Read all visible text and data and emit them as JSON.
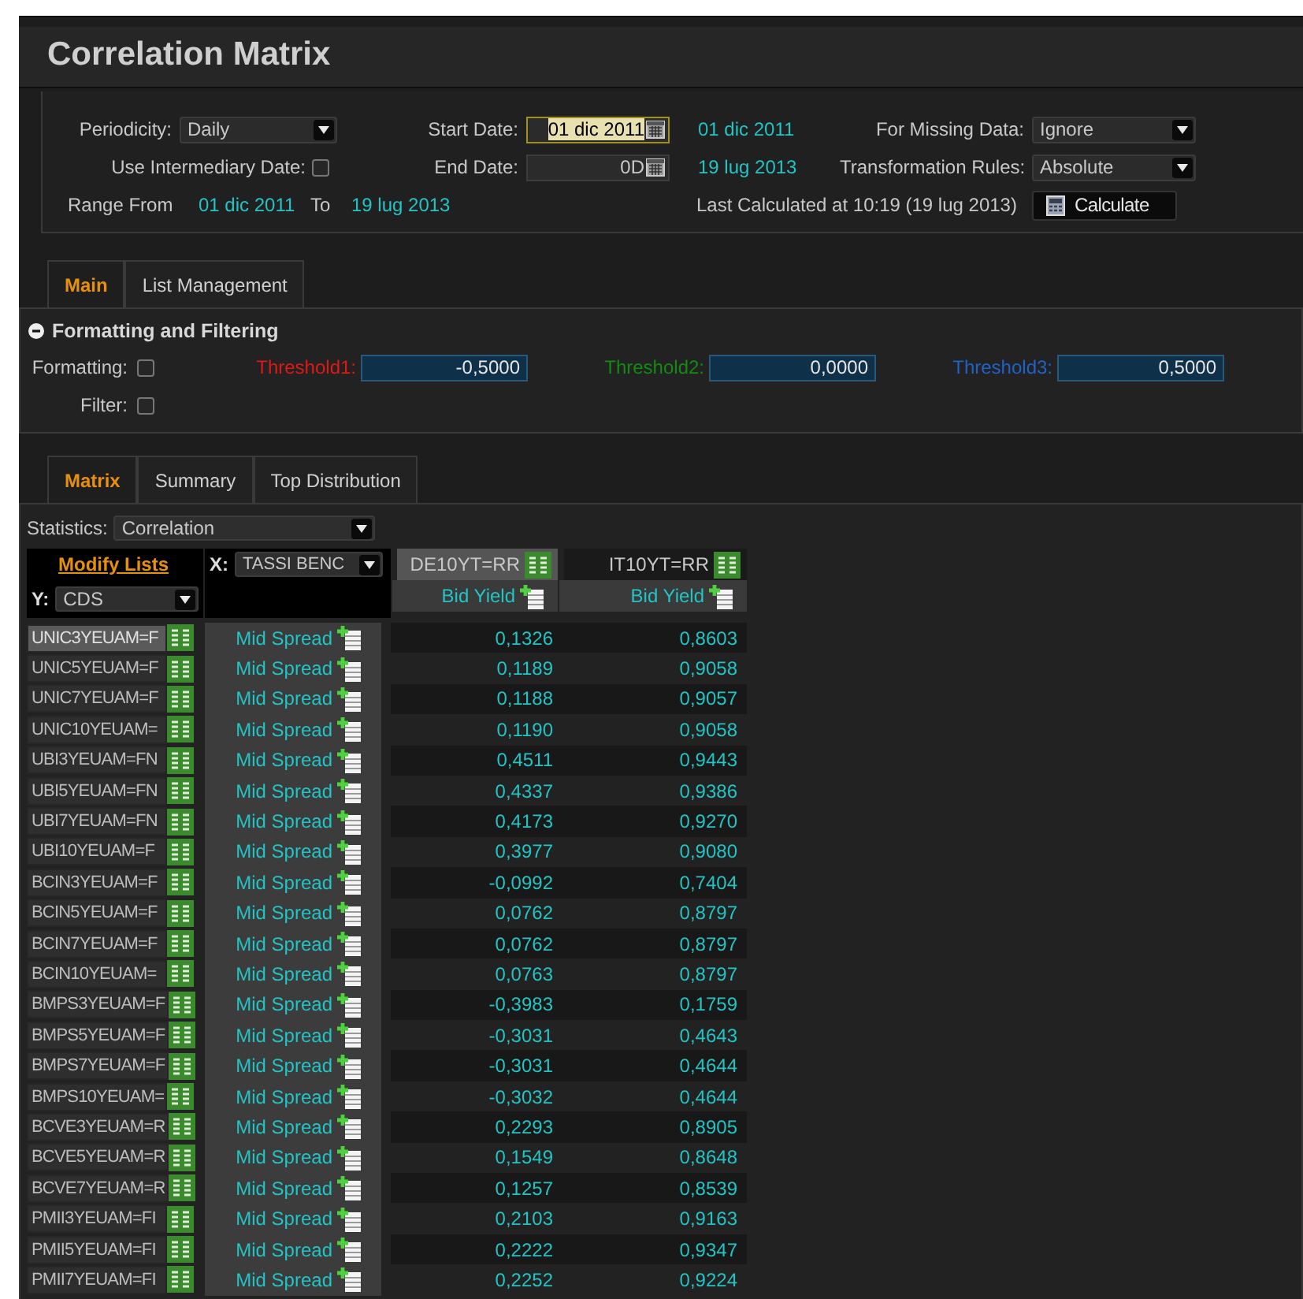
{
  "window": {
    "title": "Correlation Matrix"
  },
  "params": {
    "periodicity": {
      "label": "Periodicity:",
      "value": "Daily"
    },
    "start_date": {
      "label": "Start Date:",
      "value": "01 dic 2011",
      "focused": true,
      "echo": "01 dic 2011"
    },
    "missing_data": {
      "label": "For Missing Data:",
      "value": "Ignore"
    },
    "use_intermediary_date": {
      "label": "Use Intermediary Date:",
      "checked": false
    },
    "end_date": {
      "label": "End Date:",
      "value": "0D",
      "focused": false,
      "echo": "19 lug 2013"
    },
    "transformation": {
      "label": "Transformation Rules:",
      "value": "Absolute"
    },
    "range": {
      "from_label": "Range From",
      "from": "01 dic 2011",
      "to_label": "To",
      "to": "19 lug 2013"
    },
    "last_calculated": "Last Calculated at 10:19 (19 lug 2013)",
    "calculate_button": "Calculate"
  },
  "tabs_top": [
    {
      "label": "Main",
      "selected": true
    },
    {
      "label": "List Management",
      "selected": false
    }
  ],
  "formatting": {
    "title": "Formatting and Filtering",
    "expanded": true,
    "formatting": {
      "label": "Formatting:",
      "checked": false
    },
    "filter": {
      "label": "Filter:",
      "checked": false
    },
    "thresholds": [
      {
        "label": "Threshold1:",
        "value": "-0,5000",
        "color": "#e01818"
      },
      {
        "label": "Threshold2:",
        "value": "0,0000",
        "color": "#138a13"
      },
      {
        "label": "Threshold3:",
        "value": "0,5000",
        "color": "#1f62c8"
      }
    ]
  },
  "tabs_matrix": [
    {
      "label": "Matrix",
      "selected": true
    },
    {
      "label": "Summary",
      "selected": false
    },
    {
      "label": "Top Distribution",
      "selected": false
    }
  ],
  "statistics": {
    "label": "Statistics:",
    "value": "Correlation"
  },
  "matrix": {
    "modify_lists": "Modify Lists",
    "x_label": "X:",
    "x_value": "TASSI BENC",
    "y_label": "Y:",
    "y_value": "CDS",
    "columns": [
      {
        "name": "DE10YT=RR",
        "field": "Bid Yield",
        "selected": true
      },
      {
        "name": "IT10YT=RR",
        "field": "Bid Yield",
        "selected": false
      }
    ],
    "rows": [
      {
        "name": "UNIC3YEUAM=F",
        "field": "Mid Spread",
        "values": [
          "0,1326",
          "0,8603"
        ],
        "selected": true
      },
      {
        "name": "UNIC5YEUAM=F",
        "field": "Mid Spread",
        "values": [
          "0,1189",
          "0,9058"
        ],
        "selected": false
      },
      {
        "name": "UNIC7YEUAM=F",
        "field": "Mid Spread",
        "values": [
          "0,1188",
          "0,9057"
        ],
        "selected": false
      },
      {
        "name": "UNIC10YEUAM=",
        "field": "Mid Spread",
        "values": [
          "0,1190",
          "0,9058"
        ],
        "selected": false
      },
      {
        "name": "UBI3YEUAM=FN",
        "field": "Mid Spread",
        "values": [
          "0,4511",
          "0,9443"
        ],
        "selected": false
      },
      {
        "name": "UBI5YEUAM=FN",
        "field": "Mid Spread",
        "values": [
          "0,4337",
          "0,9386"
        ],
        "selected": false
      },
      {
        "name": "UBI7YEUAM=FN",
        "field": "Mid Spread",
        "values": [
          "0,4173",
          "0,9270"
        ],
        "selected": false
      },
      {
        "name": "UBI10YEUAM=F",
        "field": "Mid Spread",
        "values": [
          "0,3977",
          "0,9080"
        ],
        "selected": false
      },
      {
        "name": "BCIN3YEUAM=F",
        "field": "Mid Spread",
        "values": [
          "-0,0992",
          "0,7404"
        ],
        "selected": false
      },
      {
        "name": "BCIN5YEUAM=F",
        "field": "Mid Spread",
        "values": [
          "0,0762",
          "0,8797"
        ],
        "selected": false
      },
      {
        "name": "BCIN7YEUAM=F",
        "field": "Mid Spread",
        "values": [
          "0,0762",
          "0,8797"
        ],
        "selected": false
      },
      {
        "name": "BCIN10YEUAM=",
        "field": "Mid Spread",
        "values": [
          "0,0763",
          "0,8797"
        ],
        "selected": false
      },
      {
        "name": "BMPS3YEUAM=F",
        "field": "Mid Spread",
        "values": [
          "-0,3983",
          "0,1759"
        ],
        "selected": false
      },
      {
        "name": "BMPS5YEUAM=F",
        "field": "Mid Spread",
        "values": [
          "-0,3031",
          "0,4643"
        ],
        "selected": false
      },
      {
        "name": "BMPS7YEUAM=F",
        "field": "Mid Spread",
        "values": [
          "-0,3031",
          "0,4644"
        ],
        "selected": false
      },
      {
        "name": "BMPS10YEUAM=",
        "field": "Mid Spread",
        "values": [
          "-0,3032",
          "0,4644"
        ],
        "selected": false
      },
      {
        "name": "BCVE3YEUAM=R",
        "field": "Mid Spread",
        "values": [
          "0,2293",
          "0,8905"
        ],
        "selected": false
      },
      {
        "name": "BCVE5YEUAM=R",
        "field": "Mid Spread",
        "values": [
          "0,1549",
          "0,8648"
        ],
        "selected": false
      },
      {
        "name": "BCVE7YEUAM=R",
        "field": "Mid Spread",
        "values": [
          "0,1257",
          "0,8539"
        ],
        "selected": false
      },
      {
        "name": "PMII3YEUAM=FI",
        "field": "Mid Spread",
        "values": [
          "0,2103",
          "0,9163"
        ],
        "selected": false
      },
      {
        "name": "PMII5YEUAM=FI",
        "field": "Mid Spread",
        "values": [
          "0,2222",
          "0,9347"
        ],
        "selected": false
      },
      {
        "name": "PMII7YEUAM=FI",
        "field": "Mid Spread",
        "values": [
          "0,2252",
          "0,9224"
        ],
        "selected": false
      }
    ]
  }
}
